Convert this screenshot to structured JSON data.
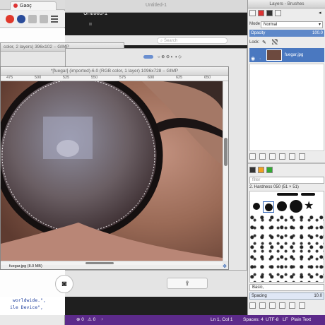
{
  "browser": {
    "tab_title": "Gaoç",
    "code_lines": [
      " worldwide.\",",
      "ile Device\","
    ]
  },
  "editor": {
    "window_title": "Untitled-1",
    "tab_title": "Untitled-1",
    "status_errors": "0",
    "status_warnings": "0",
    "status_position": "Ln 1, Col 1",
    "status_spaces": "Spaces: 4",
    "status_encoding": "UTF-8",
    "status_eol": "LF",
    "status_language": "Plain Text"
  },
  "gimp_search": {
    "placeholder": "Search"
  },
  "back_windows": [
    {
      "title": "color, 2 layers) 396x102 – GIMP"
    },
    {
      "title": "color, 2 layers) 396x102 – GIMP"
    }
  ],
  "image_window": {
    "title": "*[fuegar] (imported)-6.0 (RGB color, 1 layer) 1096x728 – GIMP",
    "ruler_ticks": [
      "475",
      "500",
      "525",
      "550",
      "575",
      "600",
      "625",
      "650"
    ],
    "status_text": "fuegar.jpg (8.0 MB)"
  },
  "dock": {
    "title": "Layers - Brushes",
    "mode_label": "Mode",
    "mode_value": "Normal",
    "opacity_label": "Opacity",
    "opacity_value": "100.0",
    "lock_label": "Lock:",
    "layer_name": "fuegar.jpg",
    "brushes_filter": "filter",
    "brush_name": "2. Hardness 050 (51 × 51)",
    "preset": "Basic,",
    "spacing_label": "Spacing",
    "spacing_value": "10.0"
  },
  "colors": {
    "status_purple": "#5c2a8a",
    "selection_blue": "#4a78c0",
    "opacity_blue": "#5e88c9"
  }
}
